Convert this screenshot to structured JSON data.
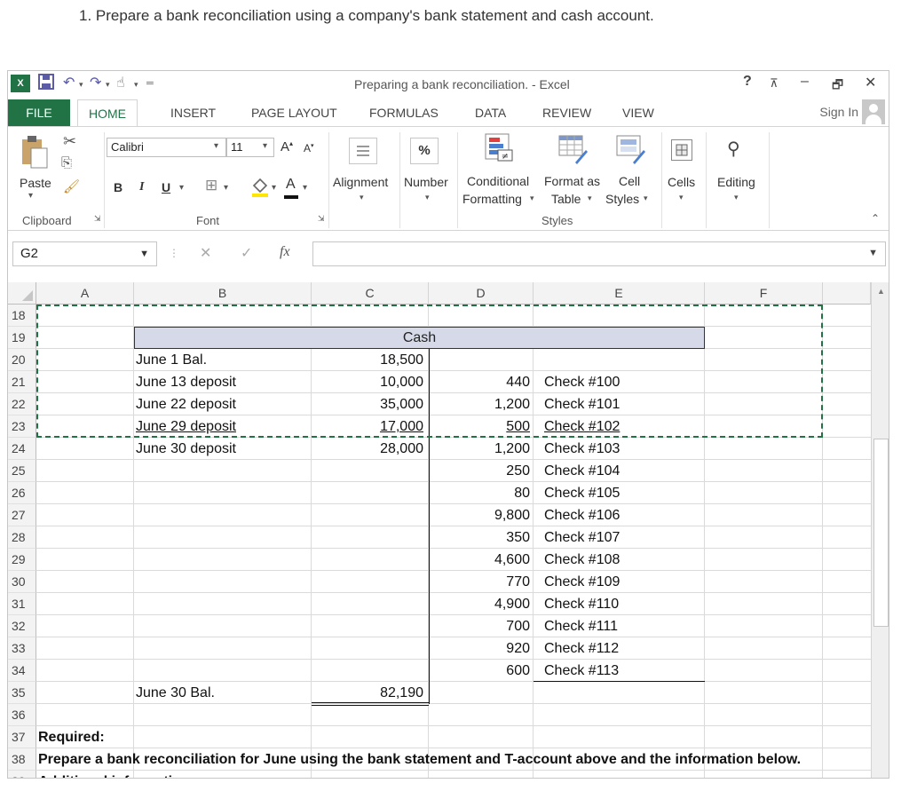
{
  "question": "1. Prepare a bank reconciliation using a company's bank statement and cash account.",
  "window": {
    "title": "Preparing a bank reconciliation. - Excel",
    "help": "?",
    "minimize": "–",
    "restore": "🗗",
    "close": "✕"
  },
  "tabs": {
    "file": "FILE",
    "items": [
      "HOME",
      "INSERT",
      "PAGE LAYOUT",
      "FORMULAS",
      "DATA",
      "REVIEW",
      "VIEW"
    ],
    "signin": "Sign In"
  },
  "ribbon": {
    "paste": "Paste",
    "clipboard": "Clipboard",
    "font_name": "Calibri",
    "font_size": "11",
    "bold": "B",
    "italic": "I",
    "underline": "U",
    "font_group": "Font",
    "alignment": "Alignment",
    "number": "Number",
    "percent": "%",
    "conditional": [
      "Conditional",
      "Formatting"
    ],
    "format_table": [
      "Format as",
      "Table"
    ],
    "cell_styles": [
      "Cell",
      "Styles"
    ],
    "styles_group": "Styles",
    "cells": "Cells",
    "editing": "Editing"
  },
  "formula_bar": {
    "name_box": "G2",
    "fx": "fx",
    "value": ""
  },
  "grid": {
    "columns": [
      "A",
      "B",
      "C",
      "D",
      "E",
      "F"
    ],
    "rows": [
      "18",
      "19",
      "20",
      "21",
      "22",
      "23",
      "24",
      "25",
      "26",
      "27",
      "28",
      "29",
      "30",
      "31",
      "32",
      "33",
      "34",
      "35",
      "36",
      "37",
      "38",
      "39"
    ],
    "cash_title": "Cash",
    "debits": [
      {
        "label": "June 1 Bal.",
        "amount": "18,500"
      },
      {
        "label": "June 13 deposit",
        "amount": "10,000"
      },
      {
        "label": "June 22 deposit",
        "amount": "35,000"
      },
      {
        "label": "June 29 deposit",
        "amount": "17,000"
      },
      {
        "label": "June 30 deposit",
        "amount": "28,000"
      }
    ],
    "credits": [
      {
        "amount": "440",
        "check": "Check #100"
      },
      {
        "amount": "1,200",
        "check": "Check #101"
      },
      {
        "amount": "500",
        "check": "Check #102"
      },
      {
        "amount": "1,200",
        "check": "Check #103"
      },
      {
        "amount": "250",
        "check": "Check #104"
      },
      {
        "amount": "80",
        "check": "Check #105"
      },
      {
        "amount": "9,800",
        "check": "Check #106"
      },
      {
        "amount": "350",
        "check": "Check #107"
      },
      {
        "amount": "4,600",
        "check": "Check #108"
      },
      {
        "amount": "770",
        "check": "Check #109"
      },
      {
        "amount": "4,900",
        "check": "Check #110"
      },
      {
        "amount": "700",
        "check": "Check #111"
      },
      {
        "amount": "920",
        "check": "Check #112"
      },
      {
        "amount": "600",
        "check": "Check #113"
      }
    ],
    "ending_label": "June 30 Bal.",
    "ending_amount": "82,190",
    "required_label": "Required:",
    "required_text": "Prepare a bank reconciliation for June using the bank statement and T-account above and the information below.",
    "additional_info": "Additional information:"
  }
}
